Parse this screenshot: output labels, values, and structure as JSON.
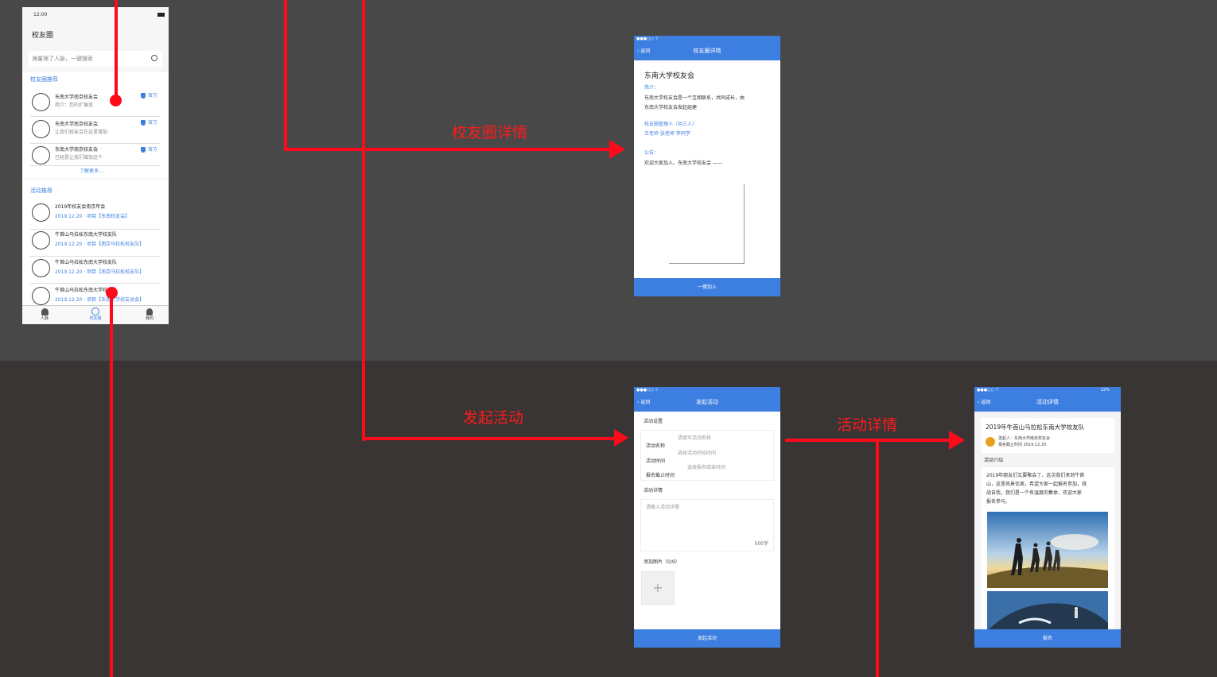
{
  "flow_labels": [
    "校友圈详情",
    "发起活动",
    "活动详情"
  ],
  "screen_list": {
    "status_time": "12:00",
    "title": "校友圈",
    "search_placeholder": "海量筛了人脉，一键搜索",
    "section1_title": "校友圈推荐",
    "clubs": [
      {
        "name": "东南大学南京校友会",
        "desc": "简介：您的扩展宽",
        "badge": "官方"
      },
      {
        "name": "东南大学南京校友会",
        "desc": "让我们校友会在这里增加",
        "badge": "官方"
      },
      {
        "name": "东南大学南京校友会",
        "desc": "已经是让我们增加这个",
        "badge": "官方"
      }
    ],
    "more": "了解更多...",
    "section2_title": "活动推荐",
    "events": [
      {
        "name": "2019年校友会南京年会",
        "meta": "2019.12.20 · 项目【东南校友会】"
      },
      {
        "name": "牛首山马拉松东南大学校友队",
        "meta": "2019.12.20 · 项目【南京马拉松校友队】"
      },
      {
        "name": "牛首山马拉松东南大学校友队",
        "meta": "2019.12.20 · 项目【南京马拉松校友队】"
      },
      {
        "name": "牛首山马拉松东南大学校友队",
        "meta": "2019.12.20 · 项目【东南大学校友总会】"
      }
    ],
    "tabs": [
      "人脉",
      "校友圈",
      "我的"
    ]
  },
  "screen_club_detail": {
    "back": "返回",
    "nav_title": "校友圈详情",
    "title": "东南大学校友会",
    "intro_label": "简介：",
    "intro_text1": "东南大学校友会是一个互相联系，共同成长，由",
    "intro_text2": "东南大学校友会发起组建",
    "admin_label": "校友圈管理人（共三人）",
    "admin_names": "王老师  张老师  李同学",
    "notice_label": "公告：",
    "notice_text": "欢迎大家加入，东南大学校友会 ——",
    "button": "一键加入"
  },
  "screen_create_event": {
    "back": "返回",
    "nav_title": "发起活动",
    "s1": "活动设置",
    "f1_label": "活动名称",
    "f1_placeholder": "请填写活动名称",
    "f2_label": "活动时间",
    "f2_placeholder": "选择活动开始时间",
    "f3_label": "报名截止时间",
    "f3_placeholder": "选择报名结束时间",
    "s2": "活动详情",
    "detail_placeholder": "请输入活动详情",
    "counter": "500字",
    "s3": "添加图片（0/9）",
    "plus": "+",
    "button": "发起活动"
  },
  "screen_event_detail": {
    "back": "返回",
    "nav_title": "活动详情",
    "status_right": "22%",
    "title": "2019年牛首山马拉松东南大学校友队",
    "host_line1": "发起人：东南大学南京校友会",
    "host_line2": "报名截止时间 2019.12.20",
    "s1": "活动介绍",
    "p1": "2019年跑友们又要聚会了，这次我们来到牛首",
    "p2": "山，这里风景优美，希望大家一起报名参加，挑",
    "p3": "战自我，我们是一个有温度的集体，欢迎大家",
    "p4": "报名参与。",
    "button": "报名"
  }
}
